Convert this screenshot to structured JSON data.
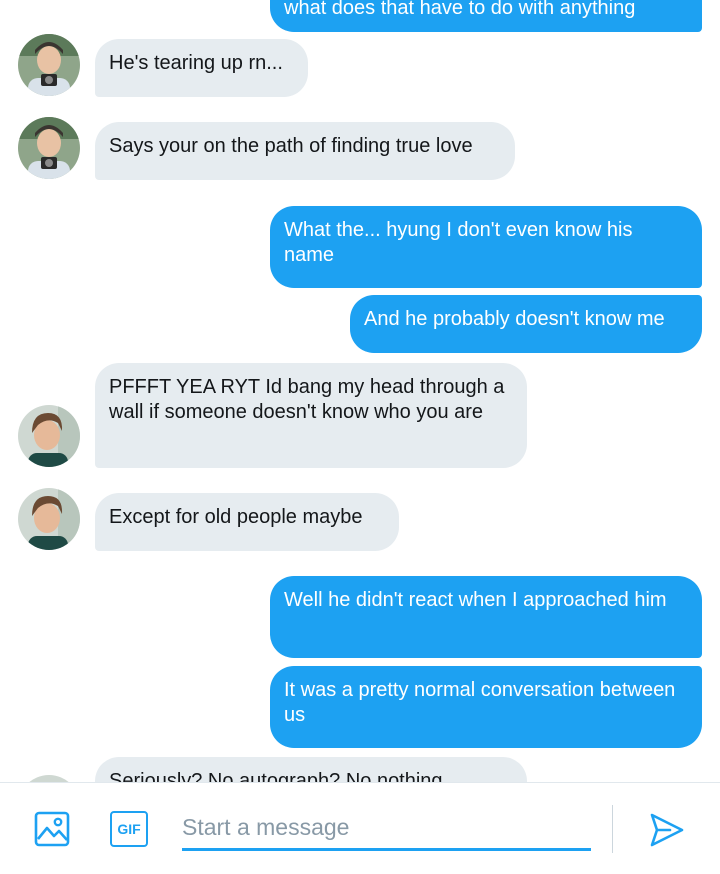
{
  "messages": [
    {
      "direction": "out",
      "text": "what does that have to do with anything",
      "avatar": null
    },
    {
      "direction": "in",
      "text": "He's tearing up rn...",
      "avatar": "namjoon"
    },
    {
      "direction": "in",
      "text": "Says your on the path of finding true love",
      "avatar": "namjoon"
    },
    {
      "direction": "out",
      "text": "What the... hyung I don't even know his name",
      "avatar": null
    },
    {
      "direction": "out",
      "text": "And he probably doesn't know me",
      "avatar": null
    },
    {
      "direction": "in",
      "text": "PFFFT YEA RYT Id bang my head through a wall if someone doesn't know who you are",
      "avatar": "jin"
    },
    {
      "direction": "in",
      "text": "Except for old people maybe",
      "avatar": "jin"
    },
    {
      "direction": "out",
      "text": "Well he didn't react when I approached him",
      "avatar": null
    },
    {
      "direction": "out",
      "text": "It was a pretty normal conversation between us",
      "avatar": null
    },
    {
      "direction": "in",
      "text": "Seriously? No autograph? No nothing",
      "avatar": "jin"
    }
  ],
  "composer": {
    "placeholder": "Start a message",
    "gif_label": "GIF",
    "image_icon": "image-icon",
    "send_icon": "send-icon"
  },
  "colors": {
    "accent": "#1da1f2",
    "incoming_bubble": "#e6ecf0",
    "incoming_text": "#14171a",
    "outgoing_text": "#ffffff"
  }
}
